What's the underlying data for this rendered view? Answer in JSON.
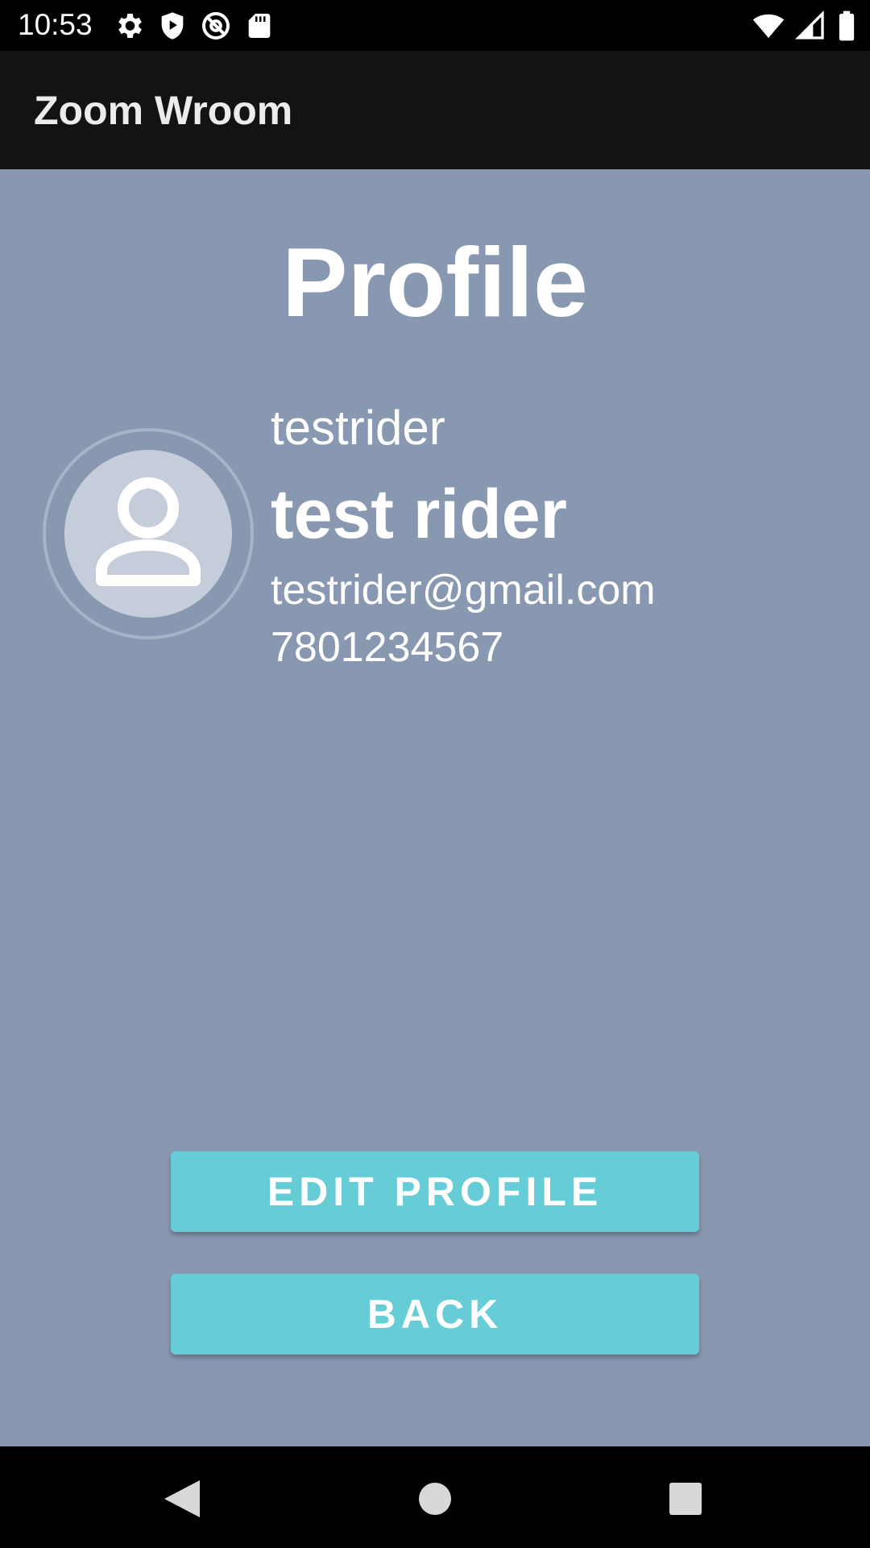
{
  "status_bar": {
    "time": "10:53",
    "left_icons": [
      "settings-icon",
      "shield-play-icon",
      "at-sign-icon",
      "sd-card-icon"
    ],
    "right_icons": [
      "wifi-icon",
      "cell-signal-icon",
      "battery-icon"
    ]
  },
  "app_bar": {
    "title": "Zoom Wroom"
  },
  "profile": {
    "title": "Profile",
    "avatar_icon": "person-icon",
    "username": "testrider",
    "full_name": "test rider",
    "email": "testrider@gmail.com",
    "phone": "7801234567"
  },
  "actions": {
    "edit_label": "EDIT PROFILE",
    "back_label": "BACK"
  },
  "nav_bar": {
    "icons": [
      "back-triangle-icon",
      "home-circle-icon",
      "recents-square-icon"
    ]
  },
  "colors": {
    "background": "#8898b0",
    "app_bar": "#131313",
    "button": "#66ccd6",
    "text": "#ffffff"
  }
}
